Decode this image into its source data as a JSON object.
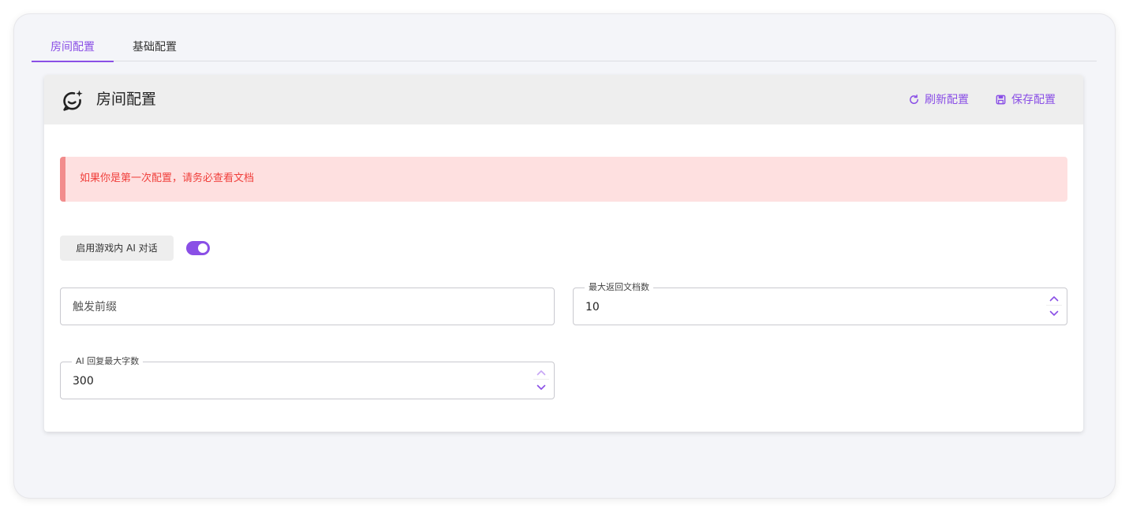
{
  "tabs": [
    {
      "label": "房间配置",
      "active": true
    },
    {
      "label": "基础配置",
      "active": false
    }
  ],
  "card": {
    "title": "房间配置",
    "icon": "ai-chat-sparkle-icon",
    "refresh_label": "刷新配置",
    "save_label": "保存配置"
  },
  "alert": {
    "text": "如果你是第一次配置，请务必查看文档"
  },
  "ai_chat": {
    "label": "启用游戏内 AI 对话",
    "enabled": true
  },
  "fields": {
    "trigger_prefix": {
      "placeholder": "触发前缀",
      "value": ""
    },
    "max_docs": {
      "label": "最大返回文档数",
      "value": "10"
    },
    "max_chars": {
      "label": "AI 回复最大字数",
      "value": "300"
    }
  },
  "colors": {
    "accent": "#8a4fe6",
    "alert_bg": "#fee0e0",
    "alert_text": "#f0403c"
  }
}
